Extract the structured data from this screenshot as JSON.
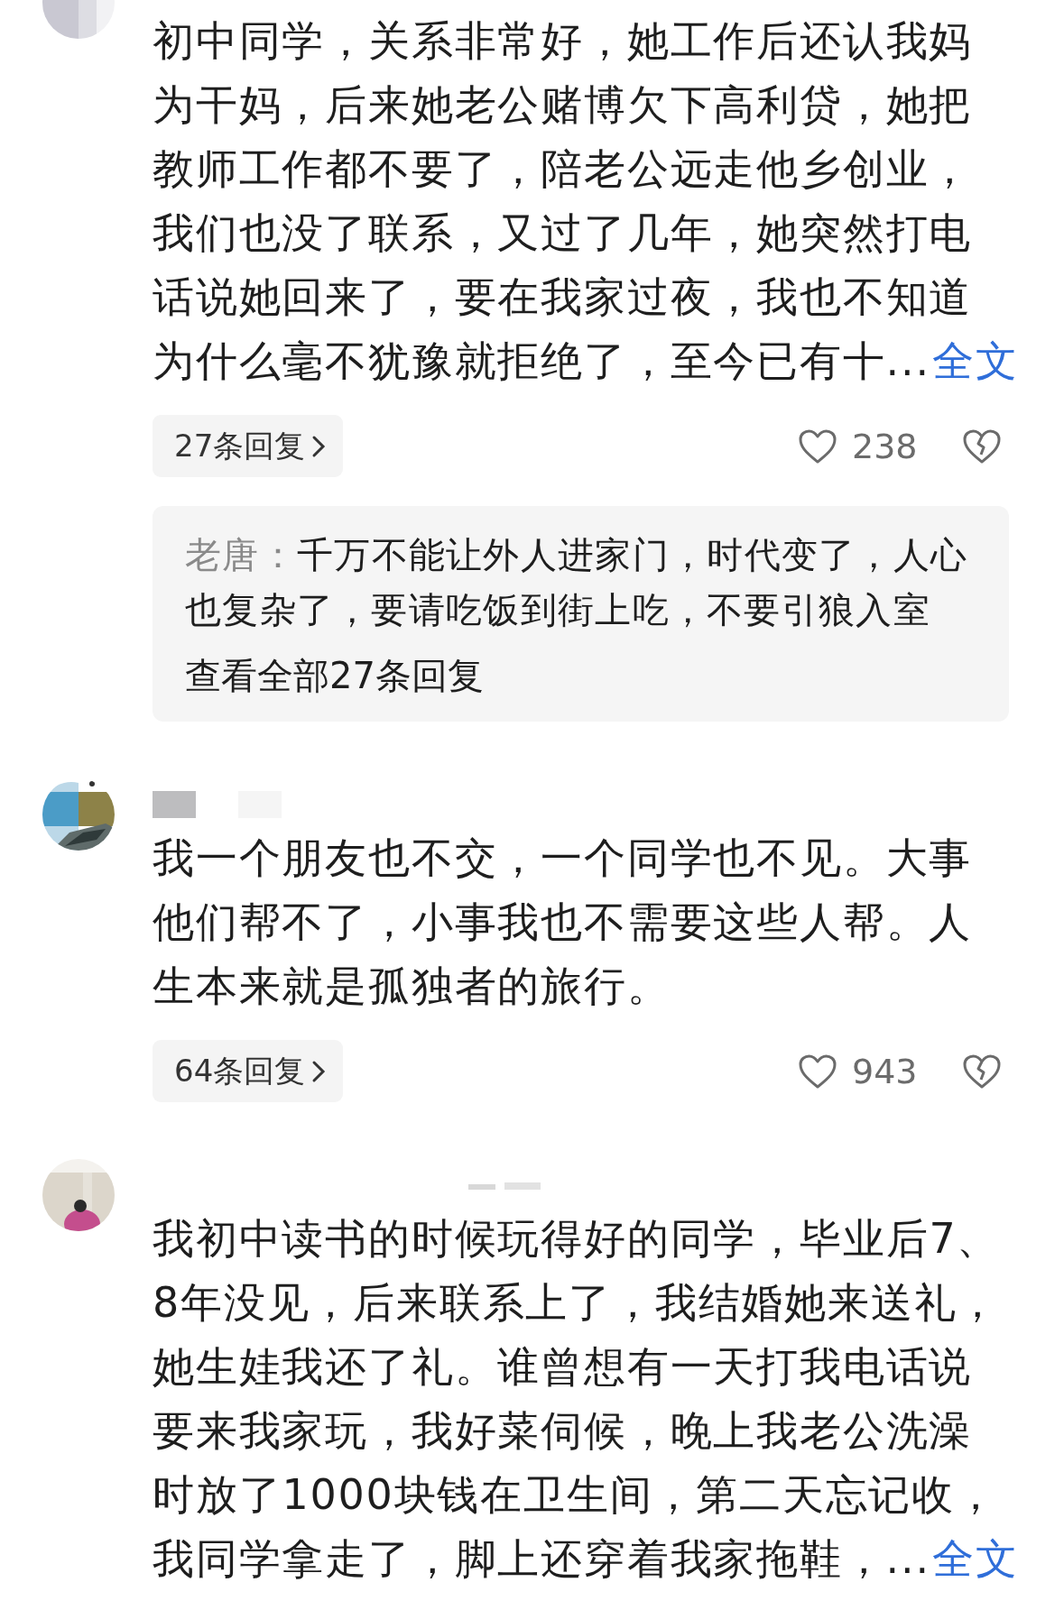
{
  "comments": [
    {
      "text": "初中同学，关系非常好，她工作后还认我妈为干妈，后来她老公赌博欠下高利贷，她把教师工作都不要了，陪老公远走他乡创业，我们也没了联系，又过了几年，她突然打电话说她回来了，要在我家过夜，我也不知道为什么毫不犹豫就拒绝了，至今已有十...",
      "more_link": "全文",
      "replies_button": "27条回复",
      "likes": "238",
      "reply_preview": {
        "author": "老唐：",
        "text": "千万不能让外人进家门，时代变了，人心也复杂了，要请吃饭到街上吃，不要引狼入室",
        "view_all": "查看全部27条回复"
      }
    },
    {
      "name_blurred": true,
      "text": "我一个朋友也不交，一个同学也不见。大事他们帮不了，小事我也不需要这些人帮。人生本来就是孤独者的旅行。",
      "replies_button": "64条回复",
      "likes": "943"
    },
    {
      "name_blurred": true,
      "text": "我初中读书的时候玩得好的同学，毕业后7、8年没见，后来联系上了，我结婚她来送礼，她生娃我还了礼。谁曾想有一天打我电话说要来我家玩，我好菜伺候，晚上我老公洗澡时放了1000块钱在卫生间，第二天忘记收，我同学拿走了，脚上还穿着我家拖鞋，...",
      "more_link": "全文"
    }
  ]
}
